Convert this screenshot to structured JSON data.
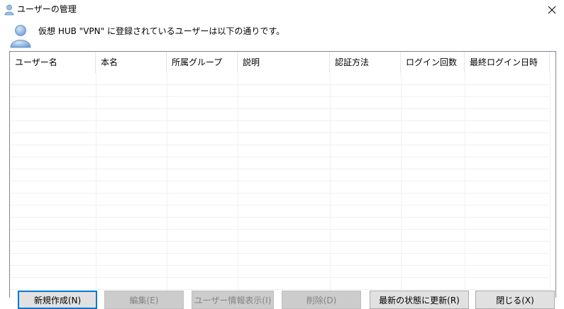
{
  "window": {
    "title": "ユーザーの管理",
    "close_glyph": "✕"
  },
  "description": "仮想 HUB \"VPN\" に登録されているユーザーは以下の通りです。",
  "table": {
    "columns": [
      "ユーザー名",
      "本名",
      "所属グループ",
      "説明",
      "認証方法",
      "ログイン回数",
      "最終ログイン日時"
    ],
    "rows": []
  },
  "buttons": [
    {
      "label": "新規作成(N)",
      "state": "default"
    },
    {
      "label": "編集(E)",
      "state": "disabled"
    },
    {
      "label": "ユーザー情報表示(I)",
      "state": "disabled"
    },
    {
      "label": "削除(D)",
      "state": "disabled"
    },
    {
      "label": "最新の状態に更新(R)",
      "state": "enabled"
    },
    {
      "label": "閉じる(X)",
      "state": "enabled"
    }
  ],
  "colors": {
    "focus_border": "#0078d7",
    "user_icon": "#7aa7d8"
  },
  "icons": {
    "window": "user-icon",
    "header": "user-icon",
    "close": "close-icon"
  }
}
